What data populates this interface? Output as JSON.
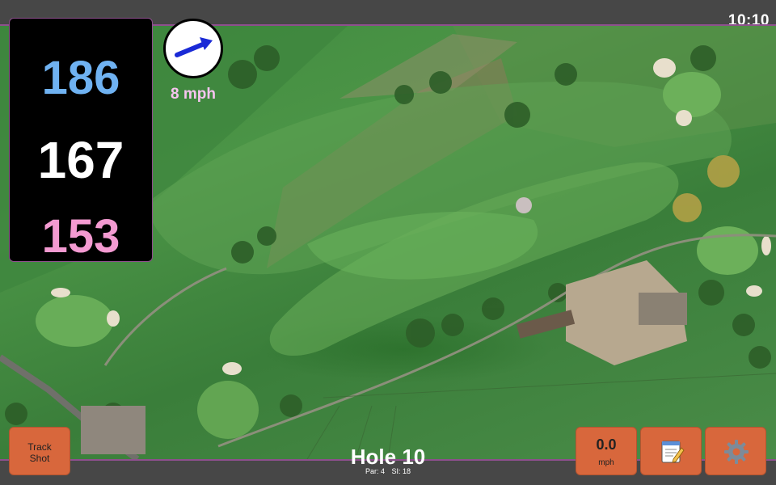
{
  "status_bar": {
    "clock": "10:10"
  },
  "yardages": {
    "back": "186",
    "center": "167",
    "front": "153"
  },
  "wind": {
    "speed_label": "8 mph",
    "arrow_icon": "wind-arrow-icon"
  },
  "hole": {
    "title": "Hole 10",
    "par_label": "Par: 4",
    "si_label": "SI: 18"
  },
  "buttons": {
    "track_shot_line1": "Track",
    "track_shot_line2": "Shot",
    "shot_speed_value": "0.0",
    "shot_speed_unit": "mph",
    "notes_icon": "notepad-icon",
    "settings_icon": "gear-icon"
  },
  "colors": {
    "back": "#6fb2f2",
    "center": "#ffffff",
    "front": "#f39ad1",
    "button": "#d8673c",
    "accent_border": "#8e4f8e"
  }
}
